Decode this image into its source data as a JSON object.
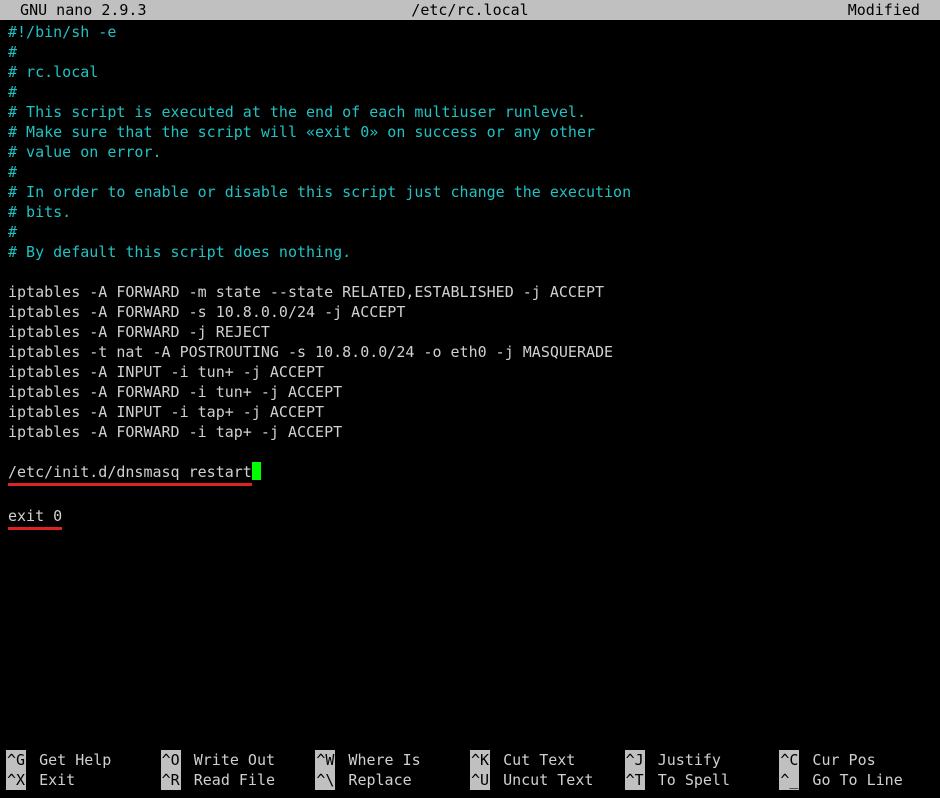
{
  "titlebar": {
    "left": "  GNU nano 2.9.3",
    "center": "/etc/rc.local",
    "right": "Modified  "
  },
  "lines": [
    {
      "text": "#!/bin/sh -e",
      "style": "comment"
    },
    {
      "text": "#",
      "style": "comment"
    },
    {
      "text": "# rc.local",
      "style": "comment"
    },
    {
      "text": "#",
      "style": "comment"
    },
    {
      "text": "# This script is executed at the end of each multiuser runlevel.",
      "style": "comment"
    },
    {
      "text": "# Make sure that the script will «exit 0» on success or any other",
      "style": "comment"
    },
    {
      "text": "# value on error.",
      "style": "comment"
    },
    {
      "text": "#",
      "style": "comment"
    },
    {
      "text": "# In order to enable or disable this script just change the execution",
      "style": "comment"
    },
    {
      "text": "# bits.",
      "style": "comment"
    },
    {
      "text": "#",
      "style": "comment"
    },
    {
      "text": "# By default this script does nothing.",
      "style": "comment"
    },
    {
      "text": " ",
      "style": "plain"
    },
    {
      "text": "iptables -A FORWARD -m state --state RELATED,ESTABLISHED -j ACCEPT",
      "style": "plain"
    },
    {
      "text": "iptables -A FORWARD -s 10.8.0.0/24 -j ACCEPT",
      "style": "plain"
    },
    {
      "text": "iptables -A FORWARD -j REJECT",
      "style": "plain"
    },
    {
      "text": "iptables -t nat -A POSTROUTING -s 10.8.0.0/24 -o eth0 -j MASQUERADE",
      "style": "plain"
    },
    {
      "text": "iptables -A INPUT -i tun+ -j ACCEPT",
      "style": "plain"
    },
    {
      "text": "iptables -A FORWARD -i tun+ -j ACCEPT",
      "style": "plain"
    },
    {
      "text": "iptables -A INPUT -i tap+ -j ACCEPT",
      "style": "plain"
    },
    {
      "text": "iptables -A FORWARD -i tap+ -j ACCEPT",
      "style": "plain"
    },
    {
      "text": " ",
      "style": "plain"
    },
    {
      "text": "/etc/init.d/dnsmasq restart",
      "style": "underline-cursor"
    },
    {
      "text": " ",
      "style": "plain"
    },
    {
      "text": "exit 0",
      "style": "underline"
    }
  ],
  "shortcuts": [
    {
      "key": "^G",
      "label": "Get Help"
    },
    {
      "key": "^O",
      "label": "Write Out"
    },
    {
      "key": "^W",
      "label": "Where Is"
    },
    {
      "key": "^K",
      "label": "Cut Text"
    },
    {
      "key": "^J",
      "label": "Justify"
    },
    {
      "key": "^C",
      "label": "Cur Pos"
    },
    {
      "key": "^X",
      "label": "Exit"
    },
    {
      "key": "^R",
      "label": "Read File"
    },
    {
      "key": "^\\",
      "label": "Replace"
    },
    {
      "key": "^U",
      "label": "Uncut Text"
    },
    {
      "key": "^T",
      "label": "To Spell"
    },
    {
      "key": "^_",
      "label": "Go To Line"
    }
  ]
}
